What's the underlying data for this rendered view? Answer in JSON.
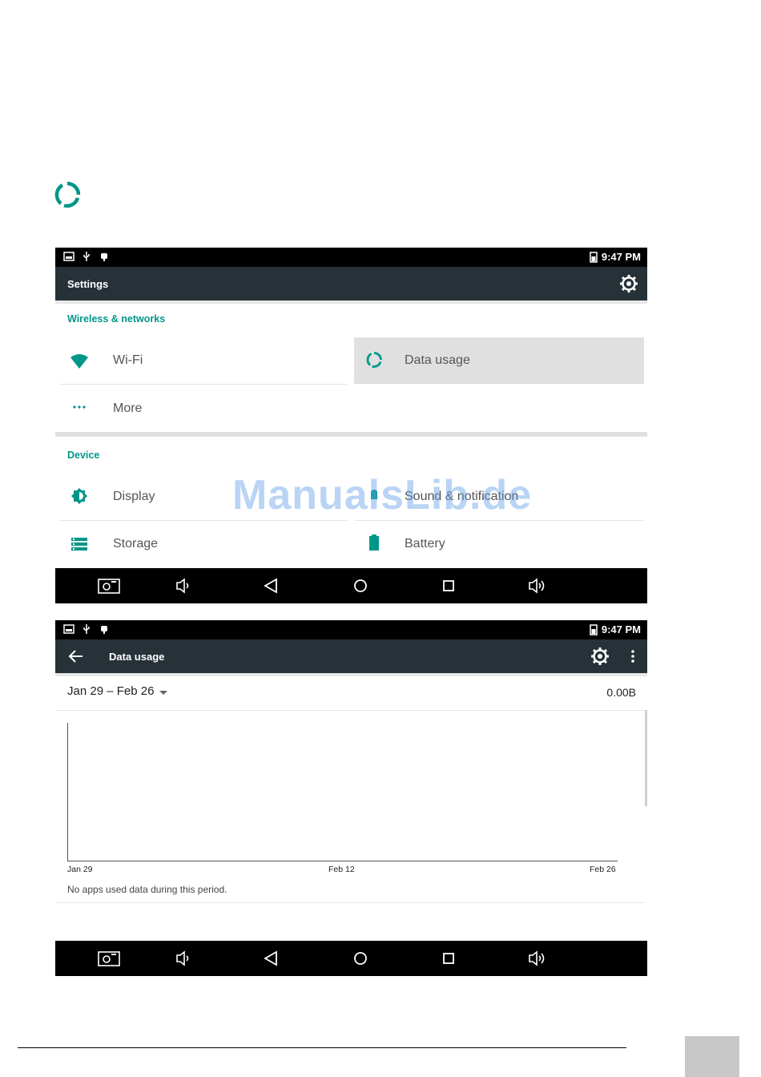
{
  "status_bar": {
    "time": "9:47 PM"
  },
  "screen1": {
    "toolbar_title": "Settings",
    "wireless_header": "Wireless & networks",
    "wifi_label": "Wi-Fi",
    "data_usage_label": "Data usage",
    "more_label": "More",
    "device_header": "Device",
    "display_label": "Display",
    "sound_label": "Sound & notification",
    "storage_label": "Storage",
    "battery_label": "Battery"
  },
  "screen2": {
    "toolbar_title": "Data usage",
    "date_range": "Jan 29 – Feb 26",
    "total_usage": "0.00B",
    "chart_data": {
      "type": "line",
      "x_ticks": [
        "Jan 29",
        "Feb 12",
        "Feb 26"
      ],
      "series": [],
      "values": []
    },
    "empty_message": "No apps used data during this period."
  },
  "watermark": "ManualsLib.de",
  "colors": {
    "accent": "#009688",
    "toolbar": "#263238",
    "selected": "#e0e0e0"
  }
}
